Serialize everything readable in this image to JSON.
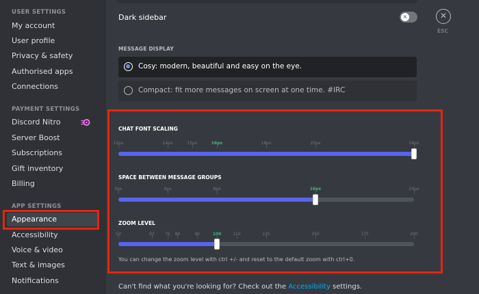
{
  "sidebar": {
    "user_settings_header": "User Settings",
    "user_items": [
      "My account",
      "User profile",
      "Privacy & safety",
      "Authorised apps",
      "Connections"
    ],
    "payment_header": "Payment Settings",
    "payment_items": [
      "Discord Nitro",
      "Server Boost",
      "Subscriptions",
      "Gift inventory",
      "Billing"
    ],
    "app_header": "App Settings",
    "app_items": [
      "Appearance",
      "Accessibility",
      "Voice & video",
      "Text & images",
      "Notifications"
    ],
    "active_item": "Appearance",
    "nitro_icon": "nitro-badge-icon"
  },
  "appearance": {
    "dark_sidebar_label": "Dark sidebar",
    "dark_sidebar_enabled": false,
    "esc_label": "ESC",
    "message_display_title": "Message Display",
    "display_options": [
      {
        "label": "Cosy: modern, beautiful and easy on the eye.",
        "selected": true
      },
      {
        "label": "Compact: fit more messages on screen at one time. #IRC",
        "selected": false
      }
    ]
  },
  "sliders": {
    "font_scaling": {
      "title": "Chat Font Scaling",
      "ticks": [
        "12px",
        "14px",
        "15px",
        "16px",
        "18px",
        "20px",
        "24px"
      ],
      "tick_values": [
        12,
        14,
        15,
        16,
        18,
        20,
        24
      ],
      "range": [
        12,
        24
      ],
      "active_tick": "16px",
      "value": 24
    },
    "message_spacing": {
      "title": "Space Between Message Groups",
      "ticks": [
        "0px",
        "4px",
        "8px",
        "16px",
        "24px"
      ],
      "tick_values": [
        0,
        4,
        8,
        16,
        24
      ],
      "range": [
        0,
        24
      ],
      "active_tick": "16px",
      "value": 16
    },
    "zoom": {
      "title": "Zoom Level",
      "ticks": [
        "50",
        "67",
        "75",
        "80",
        "90",
        "100",
        "110",
        "125",
        "150",
        "175",
        "200"
      ],
      "tick_values": [
        50,
        67,
        75,
        80,
        90,
        100,
        110,
        125,
        150,
        175,
        200
      ],
      "range": [
        50,
        200
      ],
      "active_tick": "100",
      "value": 100,
      "hint": "You can change the zoom level with ctrl +/- and reset to the default zoom with ctrl+0."
    }
  },
  "footer": {
    "text_before": "Can't find what you're looking for? Check out the ",
    "link": "Accessibility",
    "text_after": " settings."
  },
  "colors": {
    "accent": "#5865f2",
    "active_tick": "#43b581",
    "highlight": "#e8240f",
    "link": "#00b0f4"
  }
}
